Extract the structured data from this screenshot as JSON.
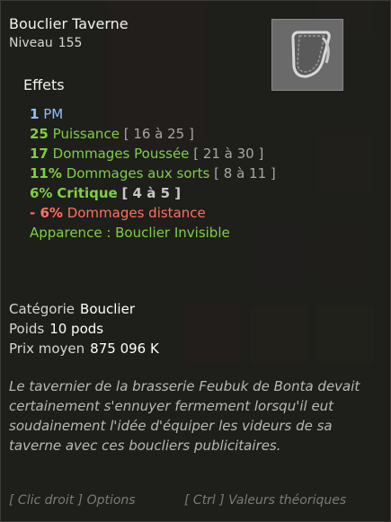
{
  "item": {
    "name": "Bouclier Taverne",
    "level_label": "Niveau",
    "level_value": "155"
  },
  "effects_title": "Effets",
  "effects": [
    {
      "value": "1",
      "text": "PM",
      "range": "",
      "style": "blue"
    },
    {
      "value": "25",
      "text": "Puissance",
      "range": "[ 16 à 25 ]",
      "style": "green"
    },
    {
      "value": "17",
      "text": "Dommages Poussée",
      "range": "[ 21 à 30 ]",
      "style": "green"
    },
    {
      "value": "11%",
      "text": "Dommages aux sorts",
      "range": "[ 8 à 11 ]",
      "style": "green"
    },
    {
      "value": "6%",
      "text": "Critique",
      "range": "[ 4 à 5 ]",
      "style": "green-bold"
    },
    {
      "value": "- 6%",
      "text": "Dommages distance",
      "range": "",
      "style": "red"
    },
    {
      "value": "",
      "text": "Apparence : Bouclier Invisible",
      "range": "",
      "style": "apparence"
    }
  ],
  "info": {
    "category_label": "Catégorie",
    "category_value": "Bouclier",
    "weight_label": "Poids",
    "weight_value": "10 pods",
    "price_label": "Prix moyen",
    "price_value": "875 096 K"
  },
  "description": "Le tavernier de la brasserie Feubuk de Bonta devait certainement s'ennuyer fermement lorsqu'il eut soudainement l'idée d'équiper les videurs de sa taverne avec ces boucliers publicitaires.",
  "footer": {
    "left": "[ Clic droit ] Options",
    "right": "[ Ctrl ] Valeurs théoriques"
  },
  "colors": {
    "blue": "#8ac2ff",
    "green": "#7fd044",
    "red": "#ff7060",
    "range_grey": "#a8a8a8"
  },
  "icons": {
    "item_image": "leather-shield-icon"
  }
}
